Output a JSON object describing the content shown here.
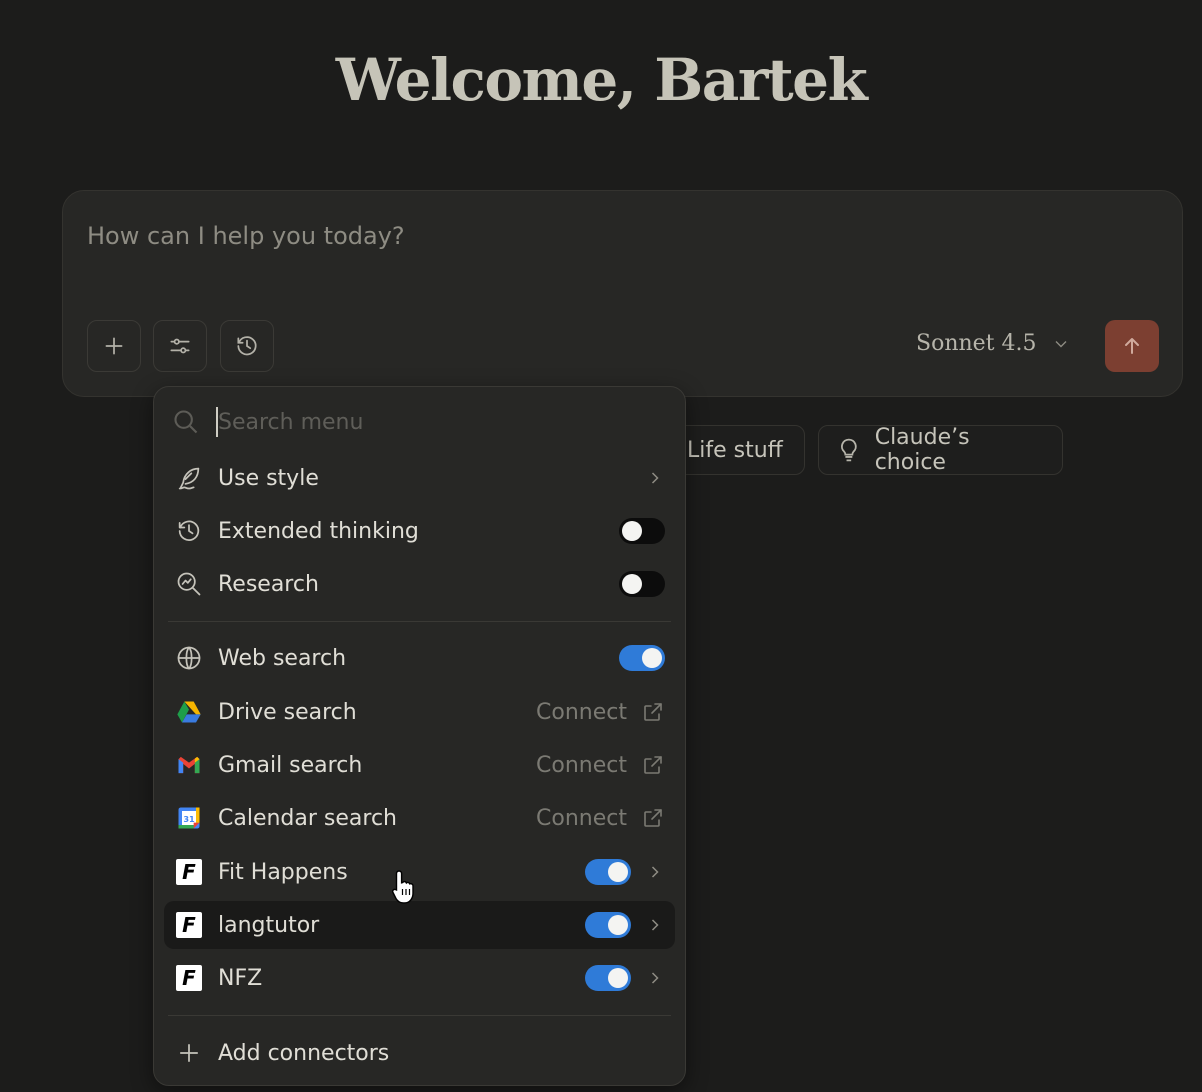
{
  "welcome": {
    "title": "Welcome, Bartek"
  },
  "composer": {
    "placeholder": "How can I help you today?",
    "model": "Sonnet 4.5",
    "add_icon": "plus-icon",
    "tools_icon": "sliders-icon",
    "thinking_icon": "clock-icon",
    "send_icon": "arrow-up-icon"
  },
  "chips": [
    {
      "label": "Life stuff"
    },
    {
      "label": "Claude’s choice",
      "icon": "lightbulb-icon"
    }
  ],
  "menu": {
    "search_placeholder": "Search menu",
    "items": [
      {
        "label": "Use style",
        "icon": "feather-icon",
        "control": "chevron"
      },
      {
        "label": "Extended thinking",
        "icon": "clock-icon",
        "control": "toggle",
        "on": false
      },
      {
        "label": "Research",
        "icon": "research-icon",
        "control": "toggle",
        "on": false
      },
      {
        "label": "Web search",
        "icon": "globe-icon",
        "control": "toggle",
        "on": true
      },
      {
        "label": "Drive search",
        "icon": "google-drive-icon",
        "control": "connect",
        "action": "Connect"
      },
      {
        "label": "Gmail search",
        "icon": "gmail-icon",
        "control": "connect",
        "action": "Connect"
      },
      {
        "label": "Calendar search",
        "icon": "google-calendar-icon",
        "control": "connect",
        "action": "Connect"
      },
      {
        "label": "Fit Happens",
        "icon": "f-logo-icon",
        "control": "toggle-chevron",
        "on": true
      },
      {
        "label": "langtutor",
        "icon": "f-logo-icon",
        "control": "toggle-chevron",
        "on": true
      },
      {
        "label": "NFZ",
        "icon": "f-logo-icon",
        "control": "toggle-chevron",
        "on": true
      }
    ],
    "add_connectors": "Add connectors"
  },
  "colors": {
    "background": "#1c1c1b",
    "send_button": "#7c3f31",
    "toggle_on": "#2f7bd8"
  }
}
